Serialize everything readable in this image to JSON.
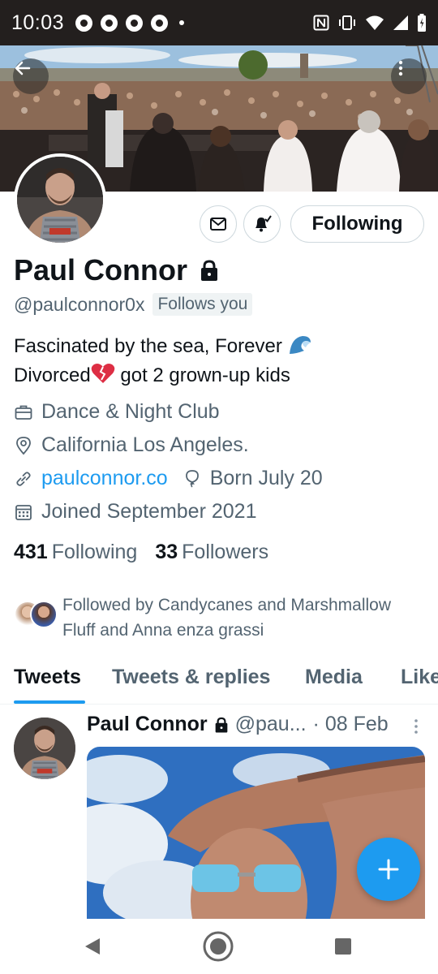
{
  "status_bar": {
    "time": "10:03",
    "left_icons": [
      "chrome-icon",
      "chrome-icon",
      "chrome-icon",
      "chrome-icon",
      "notification-dot"
    ],
    "right_icons": [
      "nfc-icon",
      "vibrate-icon",
      "wifi-icon",
      "signal-icon",
      "battery-icon"
    ]
  },
  "profile": {
    "name": "Paul Connor",
    "handle": "@paulconnor0x",
    "follows_you": "Follows you",
    "bio_line1": "Fascinated by the sea, Forever",
    "bio_line2_a": "Divorced",
    "bio_line2_b": "got 2 grown-up kids",
    "category": "Dance & Night Club",
    "location": "California Los Angeles.",
    "website": "paulconnor.co",
    "birthday": "Born July 20",
    "joined": "Joined September 2021",
    "following_count": "431",
    "following_label": "Following",
    "followers_count": "33",
    "followers_label": "Followers",
    "followed_by": "Followed by Candycanes and Marshmallow Fluff and Anna enza  grassi"
  },
  "actions": {
    "follow_button": "Following"
  },
  "tabs": [
    "Tweets",
    "Tweets & replies",
    "Media",
    "Likes"
  ],
  "tweet": {
    "name": "Paul Connor",
    "handle": "@pau...",
    "date": "· 08 Feb"
  },
  "colors": {
    "accent": "#1d9bf0",
    "secondary_text": "#536471",
    "status_bar": "#231f1e"
  }
}
